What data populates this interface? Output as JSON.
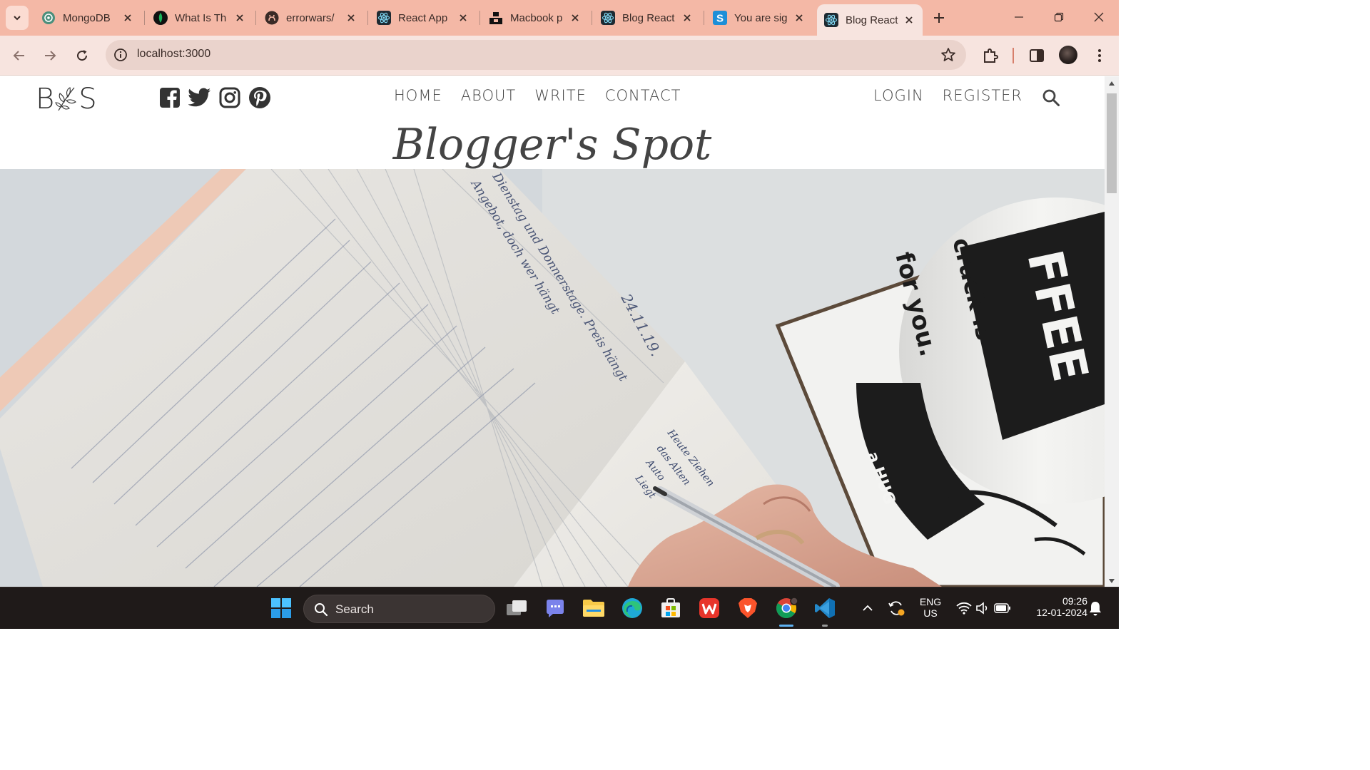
{
  "browser": {
    "tabs": [
      {
        "title": "MongoDB",
        "icon": "chatgpt-icon",
        "active": false
      },
      {
        "title": "What Is Th",
        "icon": "mongodb-leaf-icon",
        "active": false
      },
      {
        "title": "errorwars/",
        "icon": "github-icon",
        "active": false
      },
      {
        "title": "React App",
        "icon": "react-icon",
        "active": false
      },
      {
        "title": "Macbook p",
        "icon": "unsplash-icon",
        "active": false
      },
      {
        "title": "Blog React",
        "icon": "react-icon",
        "active": false
      },
      {
        "title": "You are sig",
        "icon": "s-icon",
        "active": false
      },
      {
        "title": "Blog React",
        "icon": "react-icon",
        "active": true
      }
    ],
    "address": "localhost:3000",
    "colors": {
      "frame": "#f4b8a6",
      "toolbar": "#f7e4df",
      "omnibox": "#ead3cc"
    }
  },
  "site": {
    "logo_left": "B",
    "logo_right": "S",
    "social_icons": [
      "facebook-icon",
      "twitter-icon",
      "instagram-icon",
      "pinterest-icon"
    ],
    "nav": [
      "HOME",
      "ABOUT",
      "WRITE",
      "CONTACT"
    ],
    "auth": [
      "LOGIN",
      "REGISTER"
    ],
    "title": "Blogger's Spot",
    "hero_text": {
      "notebook_date": "24.11.19.",
      "notebook_line1": "Dienstag und Donnerstage. Preis hängt",
      "notebook_line2": "Angebot, doch wer hängt",
      "notebook_line3": "Heute Ziehen",
      "notebook_line4": "das Alten",
      "notebook_line5": "Auto",
      "notebook_line6": "Liegt",
      "mug_brand": "FFEE",
      "mug_text1": "crack is",
      "mug_text2": "for you.",
      "mug_text3": "a HUG"
    }
  },
  "taskbar": {
    "search_label": "Search",
    "lang_line1": "ENG",
    "lang_line2": "US",
    "time": "09:26",
    "date": "12-01-2024"
  }
}
